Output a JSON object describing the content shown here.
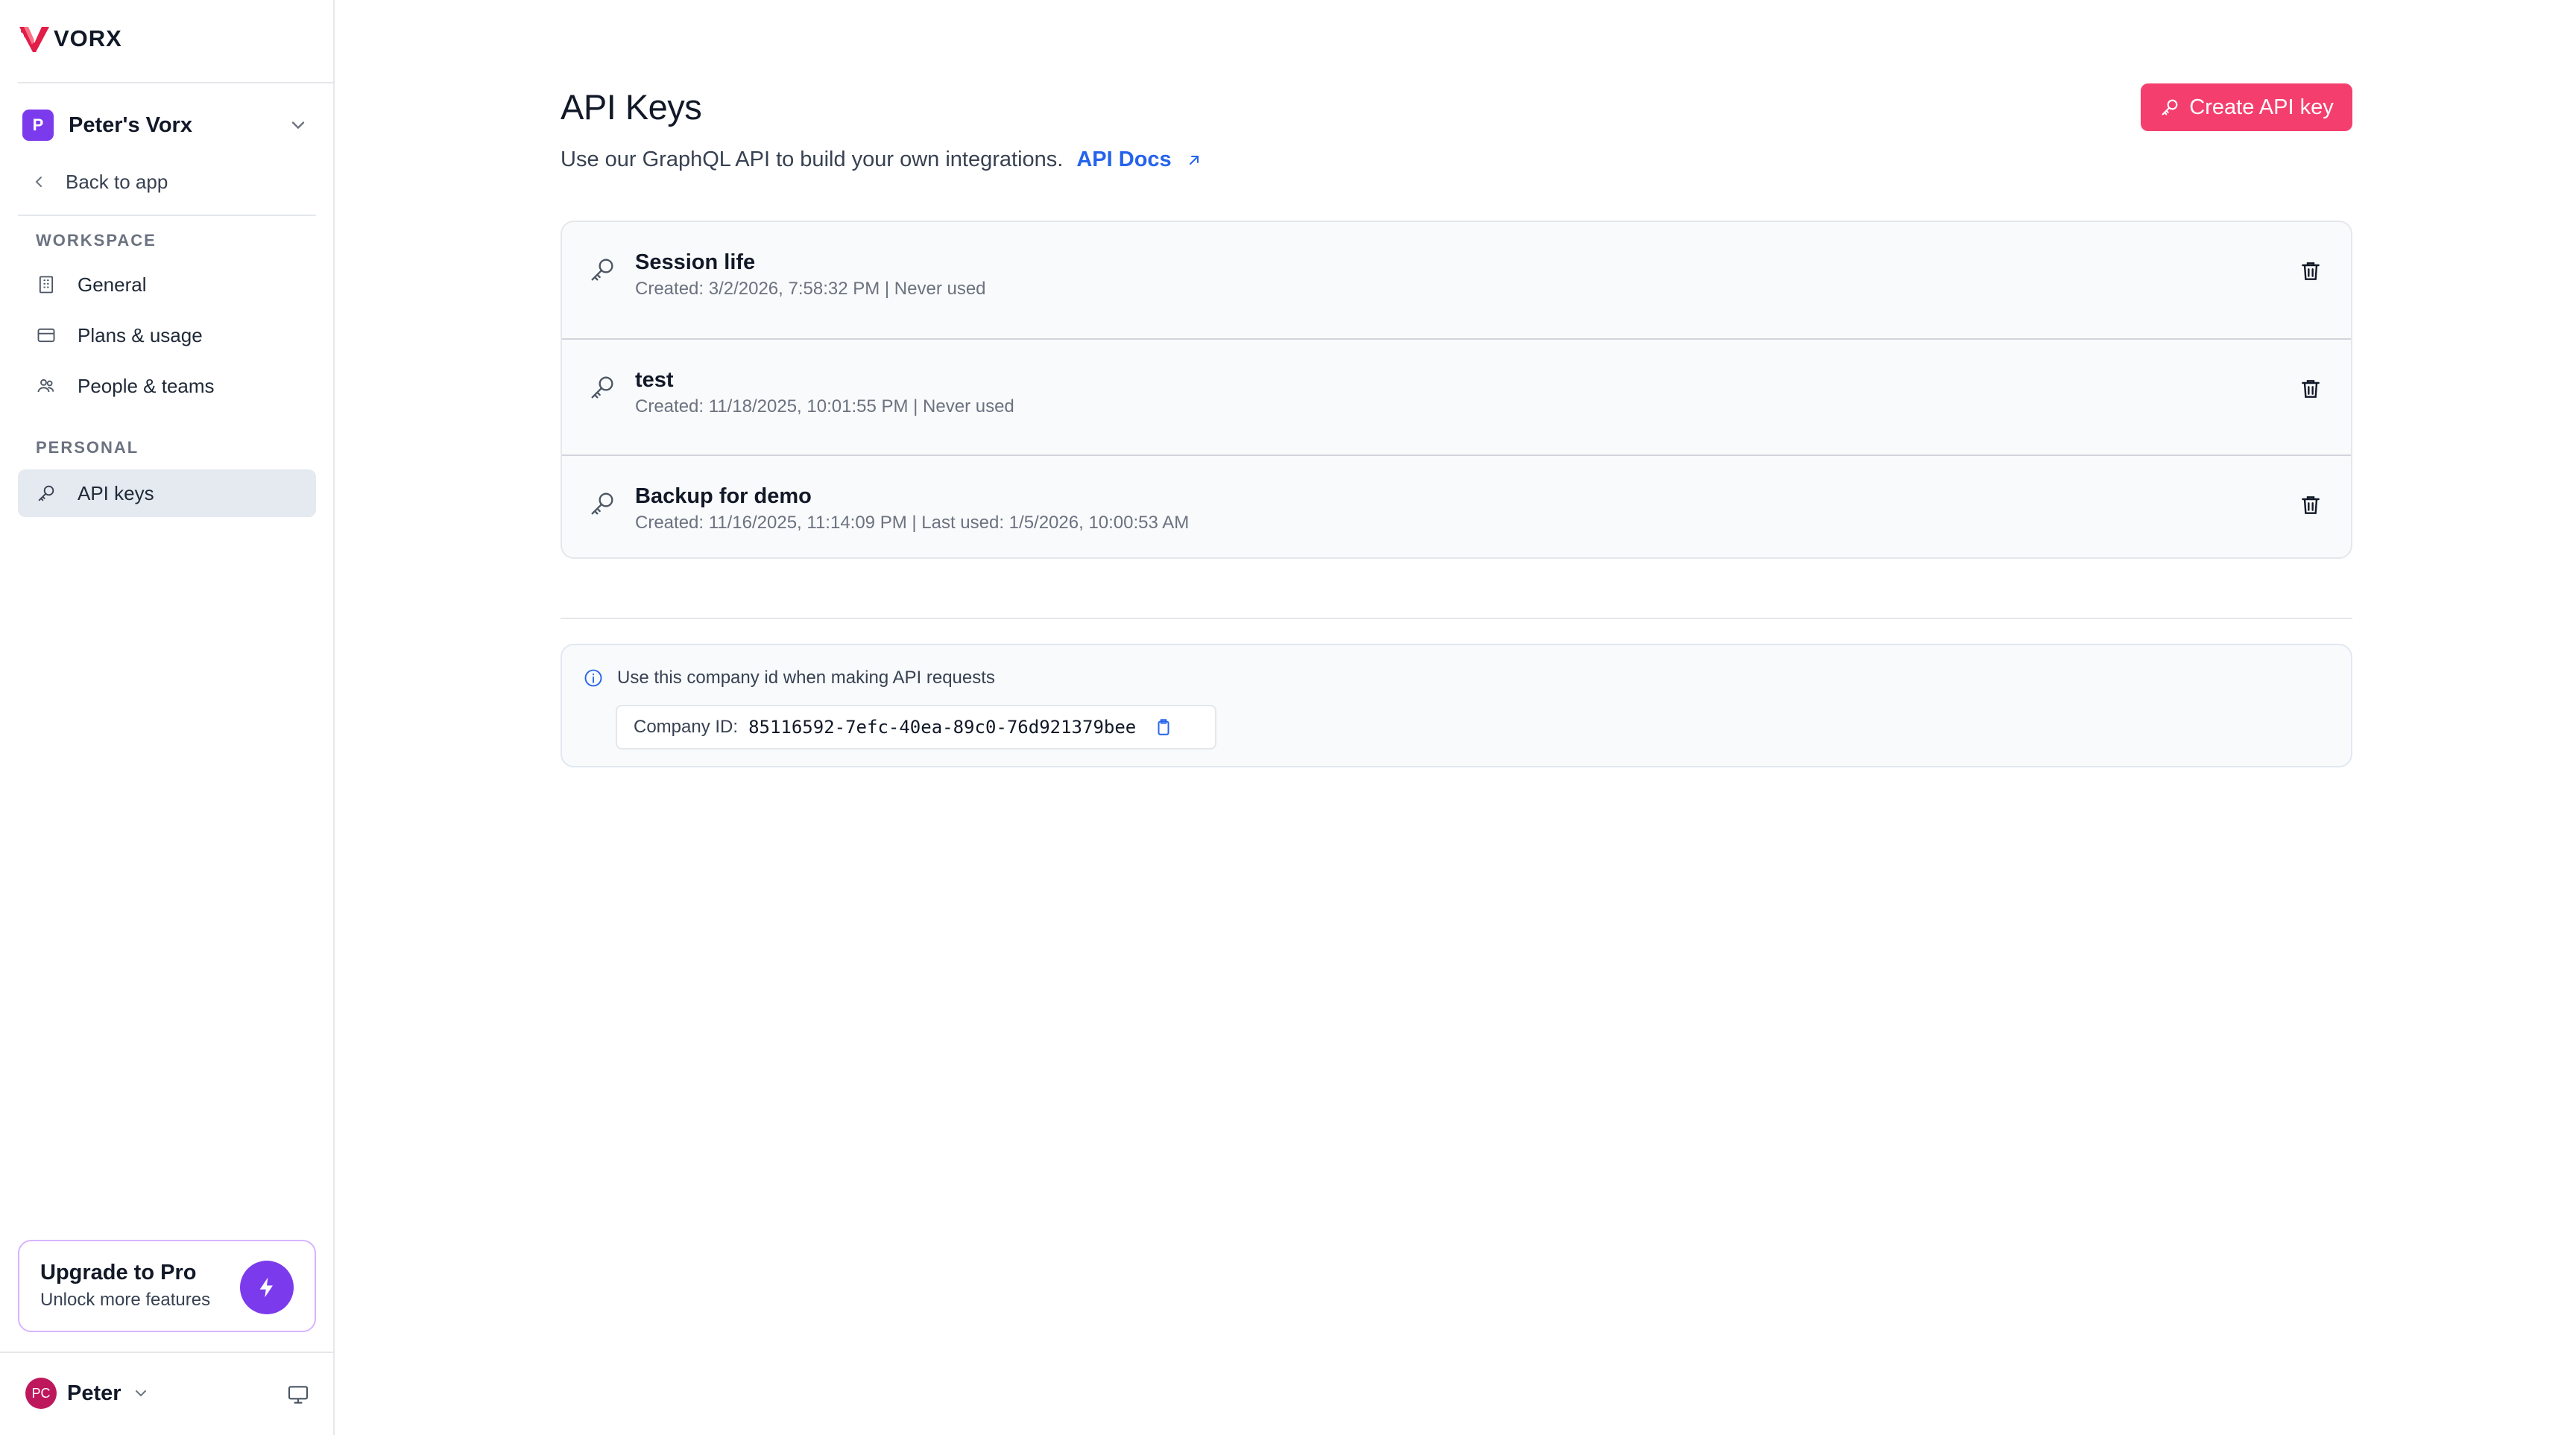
{
  "brand": {
    "name": "VORX",
    "accent": "#f43f6e",
    "purple": "#7c3aed"
  },
  "sidebar": {
    "workspace": {
      "avatar_letter": "P",
      "name": "Peter's Vorx"
    },
    "back_label": "Back to app",
    "sections": [
      {
        "label": "WORKSPACE",
        "items": [
          {
            "label": "General",
            "icon": "building-icon"
          },
          {
            "label": "Plans & usage",
            "icon": "credit-card-icon"
          },
          {
            "label": "People & teams",
            "icon": "users-icon"
          }
        ]
      },
      {
        "label": "PERSONAL",
        "items": [
          {
            "label": "API keys",
            "icon": "key-icon",
            "active": true
          }
        ]
      }
    ],
    "upgrade": {
      "title": "Upgrade to Pro",
      "subtitle": "Unlock more features"
    },
    "user": {
      "initials": "PC",
      "name": "Peter"
    }
  },
  "main": {
    "title": "API Keys",
    "subtitle": "Use our GraphQL API to build your own integrations.",
    "docs_label": "API Docs",
    "create_label": "Create API key",
    "keys": [
      {
        "name": "Session life",
        "meta": "Created: 3/2/2026, 7:58:32 PM | Never used"
      },
      {
        "name": "test",
        "meta": "Created: 11/18/2025, 10:01:55 PM | Never used"
      },
      {
        "name": "Backup for demo",
        "meta": "Created: 11/16/2025, 11:14:09 PM | Last used: 1/5/2026, 10:00:53 AM"
      }
    ],
    "company": {
      "info_text": "Use this company id when making API requests",
      "id_label": "Company ID:",
      "id_value": "85116592-7efc-40ea-89c0-76d921379bee"
    }
  }
}
